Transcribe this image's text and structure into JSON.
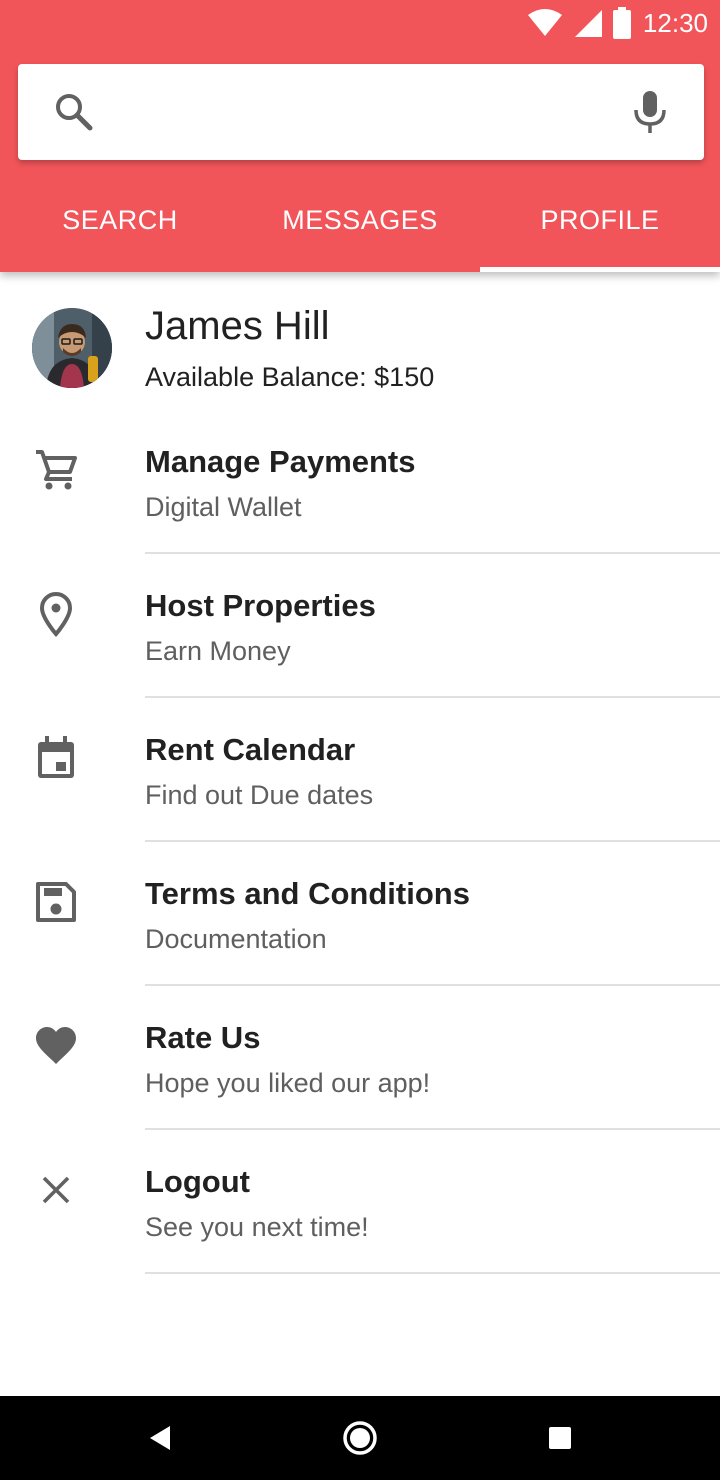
{
  "status_bar": {
    "time": "12:30",
    "icons": [
      "wifi-icon",
      "cell-signal-icon",
      "battery-icon"
    ]
  },
  "search": {
    "value": "",
    "placeholder": "",
    "icons": [
      "search-icon",
      "mic-icon"
    ]
  },
  "tabs": [
    {
      "label": "SEARCH",
      "active": false
    },
    {
      "label": "MESSAGES",
      "active": false
    },
    {
      "label": "PROFILE",
      "active": true
    }
  ],
  "profile": {
    "name": "James Hill",
    "balance": "Available Balance: $150"
  },
  "menu": [
    {
      "icon": "cart-icon",
      "title": "Manage Payments",
      "subtitle": "Digital Wallet"
    },
    {
      "icon": "location-pin-icon",
      "title": "Host Properties",
      "subtitle": "Earn Money"
    },
    {
      "icon": "calendar-icon",
      "title": "Rent Calendar",
      "subtitle": "Find out Due dates"
    },
    {
      "icon": "save-icon",
      "title": "Terms and Conditions",
      "subtitle": "Documentation"
    },
    {
      "icon": "heart-icon",
      "title": "Rate Us",
      "subtitle": "Hope you liked our app!"
    },
    {
      "icon": "close-icon",
      "title": "Logout",
      "subtitle": "See you next time!"
    }
  ],
  "nav_bar": {
    "icons": [
      "back-icon",
      "home-icon",
      "recents-icon"
    ]
  },
  "colors": {
    "accent": "#f1555a",
    "text_primary": "#212121",
    "text_secondary": "#5f5f5f",
    "icon_gray": "#616161"
  }
}
